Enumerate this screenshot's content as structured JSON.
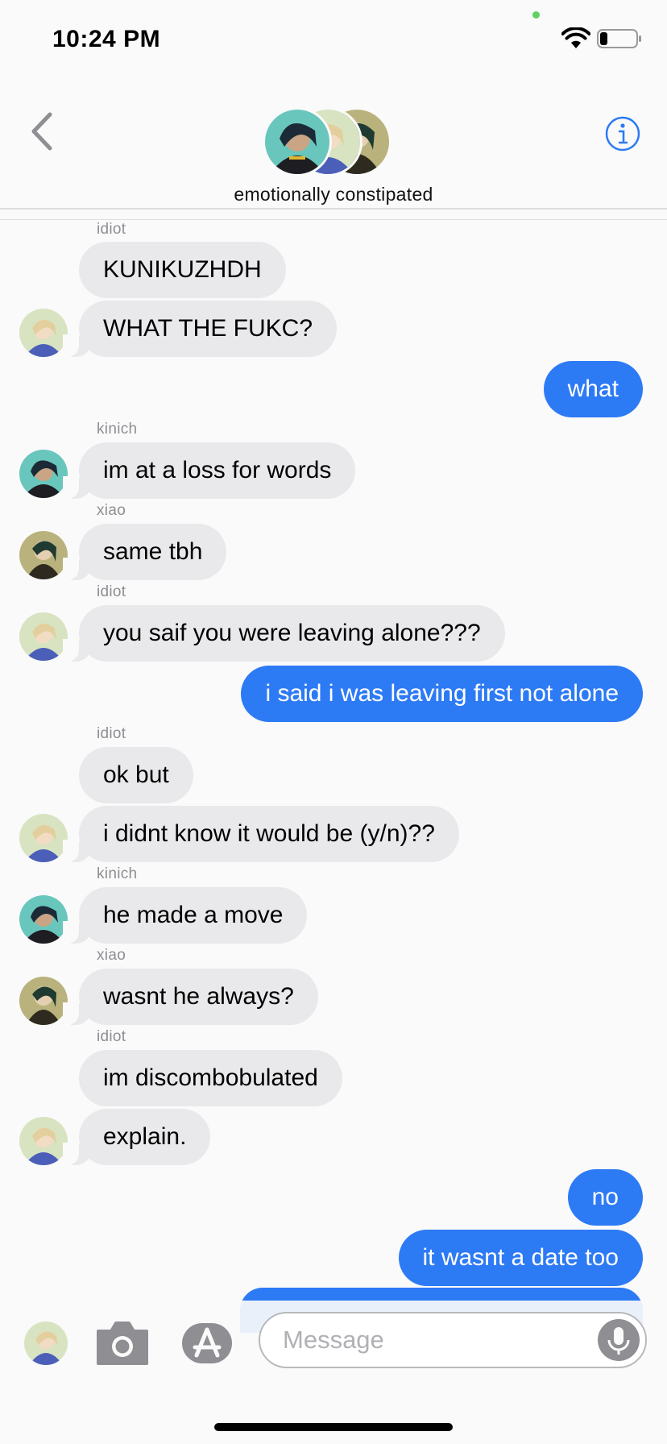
{
  "status": {
    "time": "10:24 PM"
  },
  "header": {
    "group_name": "emotionally constipated"
  },
  "messages": [
    {
      "sender": "idiot",
      "text": "KUNIKUZHDH"
    },
    {
      "text": "WHAT THE FUKC?"
    },
    {
      "text": "what"
    },
    {
      "sender": "kinich",
      "text": "im at a loss for words"
    },
    {
      "sender": "xiao",
      "text": "same tbh"
    },
    {
      "sender": "idiot",
      "text": "you saif you were leaving alone???"
    },
    {
      "text": "i said i was leaving first not alone"
    },
    {
      "sender": "idiot",
      "text": "ok but"
    },
    {
      "text": "i didnt know it would be (y/n)??"
    },
    {
      "sender": "kinich",
      "text": "he made a move"
    },
    {
      "sender": "xiao",
      "text": "wasnt he always?"
    },
    {
      "sender": "idiot",
      "text": "im discombobulated"
    },
    {
      "text": "explain."
    },
    {
      "text": "no"
    },
    {
      "text": "it wasnt a date too"
    }
  ],
  "input": {
    "placeholder": "Message"
  },
  "colors": {
    "outgoing": "#2d7af5",
    "incoming": "#e9e9eb",
    "accent": "#2d7af5"
  },
  "icons": [
    "back-chevron-icon",
    "info-icon",
    "camera-icon",
    "app-store-icon",
    "microphone-icon",
    "wifi-icon",
    "battery-icon"
  ]
}
